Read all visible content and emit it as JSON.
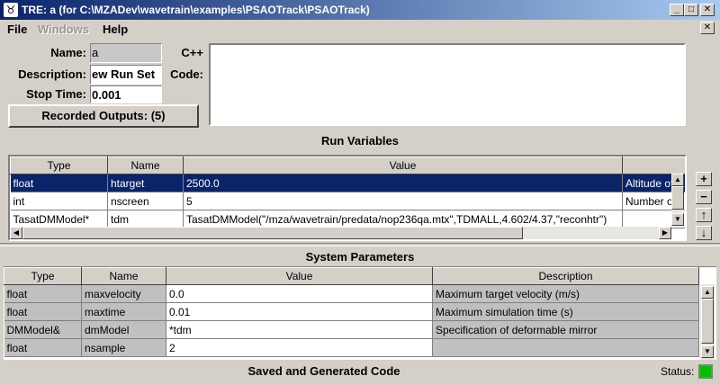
{
  "window": {
    "title": "TRE:  a (for C:\\MZADev\\wavetrain\\examples\\PSAOTrack\\PSAOTrack)",
    "icon": "tre-app-icon",
    "minimize": "_",
    "maximize": "□",
    "close": "✕"
  },
  "menu": {
    "file": "File",
    "windows": "Windows",
    "help": "Help",
    "mdi_close": "✕"
  },
  "form": {
    "name_label": "Name:",
    "name_value": "a",
    "description_label": "Description:",
    "description_value": "ew Run Set",
    "stop_time_label": "Stop Time:",
    "stop_time_value": "0.001",
    "recorded_outputs_label": "Recorded Outputs: (5)",
    "cpp_label": "C++",
    "code_label": "Code:",
    "code_value": ""
  },
  "run_variables": {
    "title": "Run Variables",
    "columns": [
      "Type",
      "Name",
      "Value"
    ],
    "rows": [
      {
        "type": "float",
        "name": "htarget",
        "value": "2500.0",
        "desc": "Altitude of"
      },
      {
        "type": "int",
        "name": "nscreen",
        "value": "5",
        "desc": "Number of"
      },
      {
        "type": "TasatDMModel*",
        "name": "tdm",
        "value": "TasatDMModel(\"/mza/wavetrain/predata/nop236qa.mtx\",TDMALL,4.602/4.37,\"reconhtr\")",
        "desc": ""
      }
    ],
    "side_buttons": [
      "+",
      "−",
      "↑",
      "↓"
    ]
  },
  "system_parameters": {
    "title": "System Parameters",
    "columns": [
      "Type",
      "Name",
      "Value",
      "Description"
    ],
    "rows": [
      {
        "type": "float",
        "name": "maxvelocity",
        "value": "0.0",
        "desc": "Maximum target velocity (m/s)"
      },
      {
        "type": "float",
        "name": "maxtime",
        "value": "0.01",
        "desc": "Maximum simulation time (s)"
      },
      {
        "type": "DMModel&",
        "name": "dmModel",
        "value": "*tdm",
        "desc": "Specification of deformable mirror"
      },
      {
        "type": "float",
        "name": "nsample",
        "value": "2",
        "desc": ""
      }
    ]
  },
  "footer": {
    "saved_code_label": "Saved and Generated Code",
    "status_label": "Status:",
    "status_color": "#00c000"
  }
}
